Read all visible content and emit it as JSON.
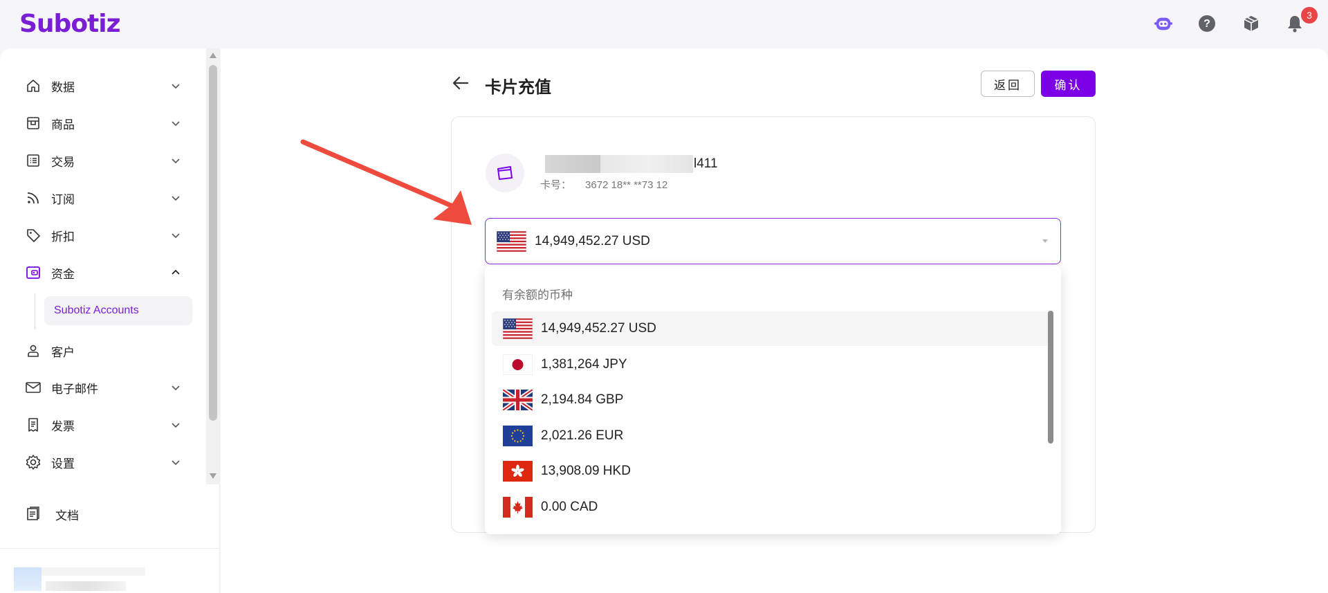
{
  "brand": {
    "logo": "Subotiz",
    "accent": "#7a00e6"
  },
  "topbar": {
    "icons": [
      "assistant-bot-icon",
      "help-icon",
      "package-icon",
      "bell-icon"
    ],
    "notification_count": "3"
  },
  "sidebar": {
    "items": [
      {
        "label": "数据",
        "icon": "home-icon",
        "expandable": true,
        "expanded": false
      },
      {
        "label": "商品",
        "icon": "shop-icon",
        "expandable": true,
        "expanded": false
      },
      {
        "label": "交易",
        "icon": "list-icon",
        "expandable": true,
        "expanded": false
      },
      {
        "label": "订阅",
        "icon": "rss-icon",
        "expandable": true,
        "expanded": false
      },
      {
        "label": "折扣",
        "icon": "tag-icon",
        "expandable": true,
        "expanded": false
      },
      {
        "label": "资金",
        "icon": "wallet-icon",
        "expandable": true,
        "expanded": true
      },
      {
        "label": "客户",
        "icon": "user-icon",
        "expandable": false
      },
      {
        "label": "电子邮件",
        "icon": "mail-icon",
        "expandable": true,
        "expanded": false
      },
      {
        "label": "发票",
        "icon": "invoice-icon",
        "expandable": true,
        "expanded": false
      },
      {
        "label": "设置",
        "icon": "gear-icon",
        "expandable": true,
        "expanded": false
      }
    ],
    "sub_item": "Subotiz Accounts",
    "docs": "文档"
  },
  "page": {
    "title": "卡片充值",
    "back_button": "返回",
    "confirm_button": "确认"
  },
  "card": {
    "name_suffix": "l411",
    "number_label": "卡号：",
    "number": "3672 18** **73 12"
  },
  "currency_select": {
    "selected": "14,949,452.27 USD",
    "dropdown_label": "有余额的币种",
    "options": [
      {
        "text": "14,949,452.27 USD",
        "flag": "us-flag-icon"
      },
      {
        "text": "1,381,264 JPY",
        "flag": "jp-flag-icon"
      },
      {
        "text": "2,194.84 GBP",
        "flag": "gb-flag-icon"
      },
      {
        "text": "2,021.26 EUR",
        "flag": "eu-flag-icon"
      },
      {
        "text": "13,908.09 HKD",
        "flag": "hk-flag-icon"
      },
      {
        "text": "0.00 CAD",
        "flag": "ca-flag-icon"
      }
    ]
  }
}
